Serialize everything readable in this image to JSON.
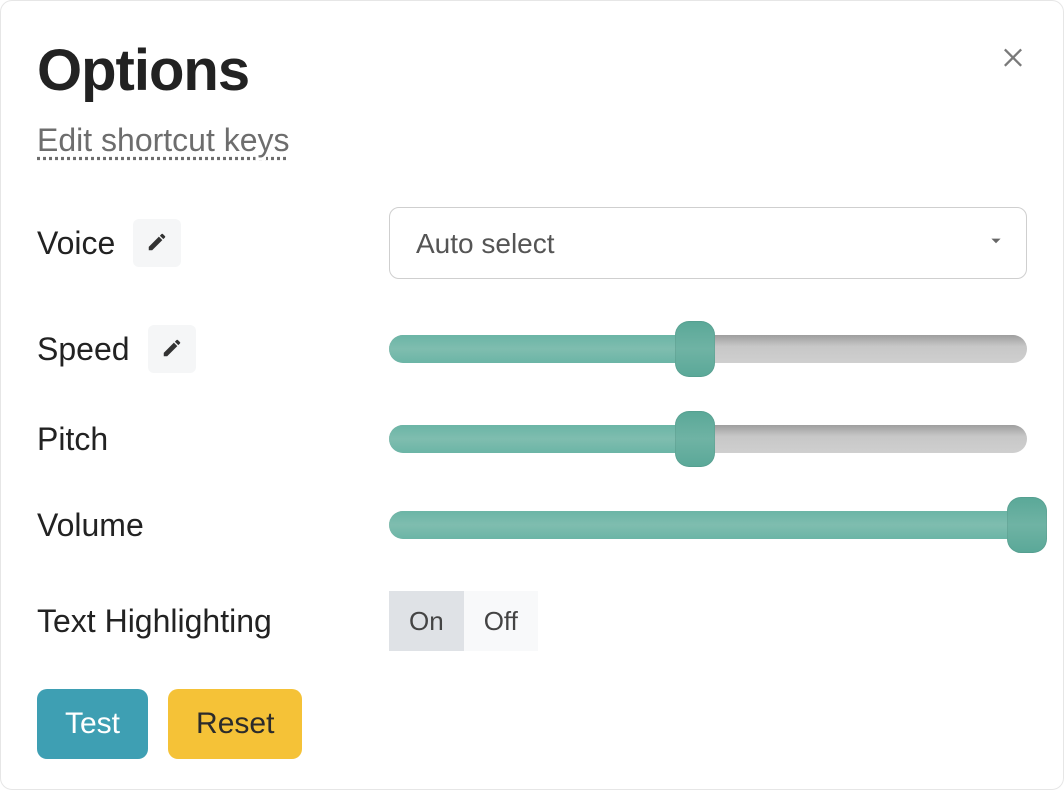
{
  "header": {
    "title": "Options",
    "shortcut_link": "Edit shortcut keys"
  },
  "rows": {
    "voice": {
      "label": "Voice",
      "selected": "Auto select"
    },
    "speed": {
      "label": "Speed",
      "percent": 48
    },
    "pitch": {
      "label": "Pitch",
      "percent": 48
    },
    "volume": {
      "label": "Volume",
      "percent": 100
    },
    "highlight": {
      "label": "Text Highlighting",
      "on": "On",
      "off": "Off",
      "value": "On"
    }
  },
  "footer": {
    "test": "Test",
    "reset": "Reset"
  }
}
